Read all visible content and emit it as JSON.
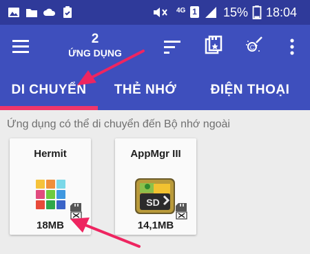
{
  "status_bar": {
    "network": "4G",
    "sim": "1",
    "battery": "15%",
    "time": "18:04",
    "icons": [
      "gallery-icon",
      "folder-icon",
      "cloud-icon",
      "clipboard-check-icon",
      "mute-vibrate-icon",
      "signal-icon",
      "battery-icon"
    ]
  },
  "app_bar": {
    "count": "2",
    "count_label": "ỨNG DỤNG",
    "icons": [
      "menu-icon",
      "sort-icon",
      "storage-icon",
      "clean-icon",
      "more-vert-icon"
    ]
  },
  "tabs": [
    {
      "label": "DI CHUYỂN",
      "selected": true
    },
    {
      "label": "THẺ NHỚ",
      "selected": false
    },
    {
      "label": "ĐIỆN THOẠI",
      "selected": false
    }
  ],
  "subtitle": "Ứng dụng có thể di chuyển đến Bộ nhớ ngoài",
  "apps": [
    {
      "name": "Hermit",
      "size": "18MB",
      "icon": "hermit-app-icon"
    },
    {
      "name": "AppMgr III",
      "size": "14,1MB",
      "icon": "appmgr-app-icon"
    }
  ],
  "colors": {
    "status_bar": "#2f3a9a",
    "app_bar": "#3e4fbd",
    "tab_indicator": "#f0366b",
    "annotation_arrow": "#ee2560",
    "background": "#ececec"
  }
}
